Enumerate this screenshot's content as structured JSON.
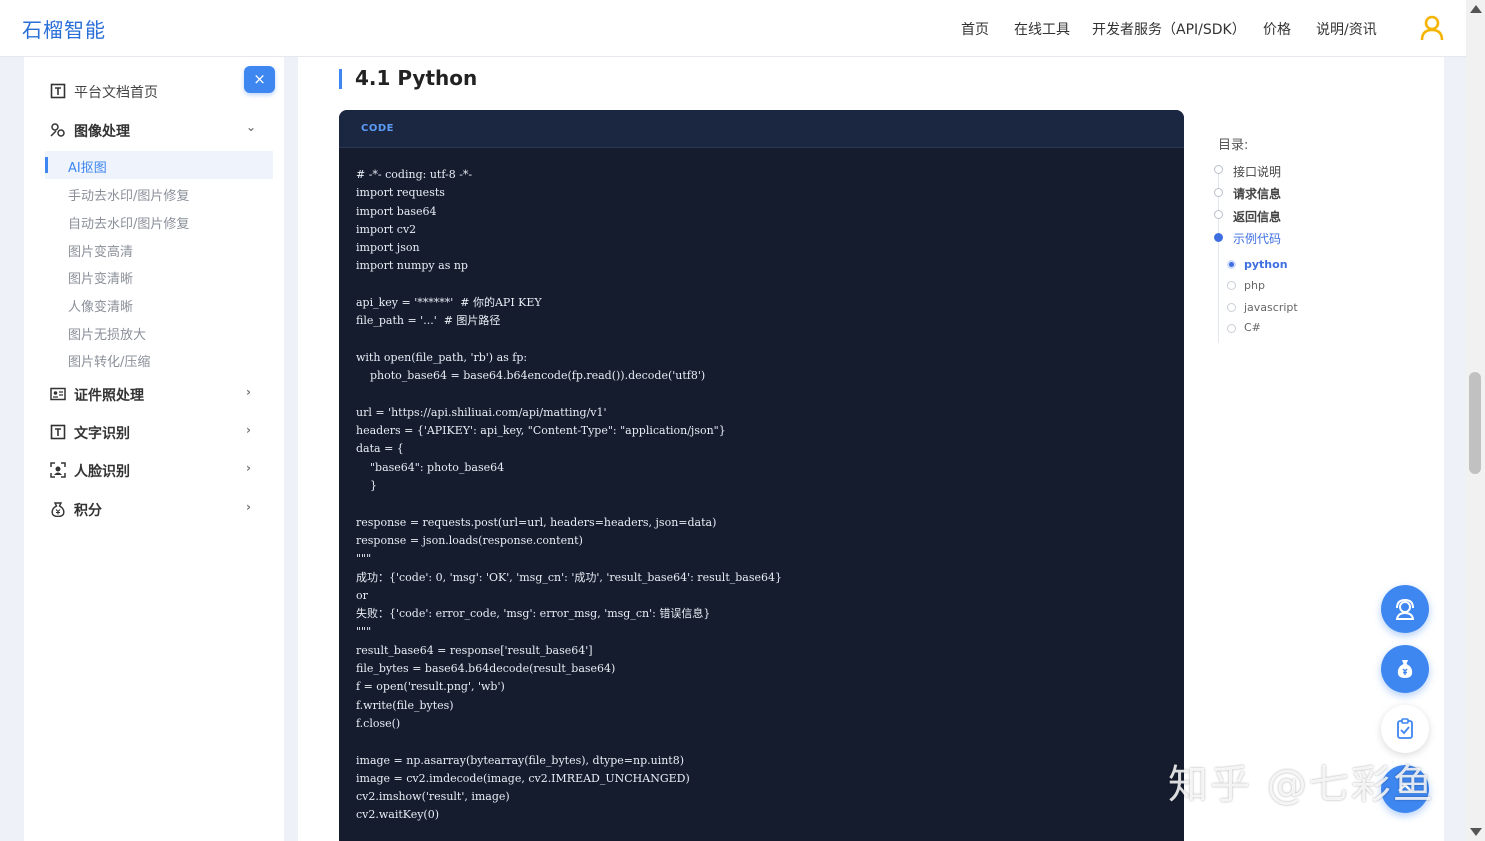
{
  "header": {
    "brand": "石榴智能",
    "nav": [
      "首页",
      "在线工具",
      "开发者服务（API/SDK）",
      "价格",
      "说明/资讯"
    ]
  },
  "sidebar": {
    "close_glyph": "×",
    "top_item": "平台文档首页",
    "groups": [
      {
        "label": "图像处理",
        "icon": "image-process-icon",
        "expanded": true
      },
      {
        "label": "证件照处理",
        "icon": "id-photo-icon"
      },
      {
        "label": "文字识别",
        "icon": "text-ocr-icon"
      },
      {
        "label": "人脸识别",
        "icon": "face-scan-icon"
      },
      {
        "label": "积分",
        "icon": "points-icon"
      }
    ],
    "sub_items": [
      "AI抠图",
      "手动去水印/图片修复",
      "自动去水印/图片修复",
      "图片变高清",
      "图片变清晰",
      "人像变清晰",
      "图片无损放大",
      "图片转化/压缩"
    ],
    "active_sub": "AI抠图"
  },
  "main": {
    "section_title": "4.1 Python",
    "code_tag": "CODE",
    "code": "# -*- coding: utf-8 -*-\nimport requests\nimport base64\nimport cv2\nimport json\nimport numpy as np\n\napi_key = '******'  # 你的API KEY\nfile_path = '...'  # 图片路径\n\nwith open(file_path, 'rb') as fp:\n    photo_base64 = base64.b64encode(fp.read()).decode('utf8')\n\nurl = 'https://api.shiliuai.com/api/matting/v1'\nheaders = {'APIKEY': api_key, \"Content-Type\": \"application/json\"}\ndata = {\n    \"base64\": photo_base64\n    }\n\nresponse = requests.post(url=url, headers=headers, json=data)\nresponse = json.loads(response.content)\n\"\"\"\n成功：{'code': 0, 'msg': 'OK', 'msg_cn': '成功', 'result_base64': result_base64}\nor\n失败：{'code': error_code, 'msg': error_msg, 'msg_cn': 错误信息}\n\"\"\"\nresult_base64 = response['result_base64']\nfile_bytes = base64.b64decode(result_base64)\nf = open('result.png', 'wb')\nf.write(file_bytes)\nf.close()\n\nimage = np.asarray(bytearray(file_bytes), dtype=np.uint8)\nimage = cv2.imdecode(image, cv2.IMREAD_UNCHANGED)\ncv2.imshow('result', image)\ncv2.waitKey(0)"
  },
  "toc": {
    "title": "目录:",
    "items": [
      "接口说明",
      "请求信息",
      "返回信息",
      "示例代码"
    ],
    "active_item": "示例代码",
    "sub_items": [
      "python",
      "php",
      "javascript",
      "C#"
    ],
    "active_sub": "python"
  },
  "floating_buttons": [
    "customer-service-icon",
    "money-bag-icon",
    "clipboard-check-icon",
    "back-to-top-icon"
  ],
  "watermark": "知乎 @七彩鱼",
  "colors": {
    "accent": "#3e86f0",
    "code_bg": "#141c2e",
    "brand": "#2a6fd8"
  }
}
